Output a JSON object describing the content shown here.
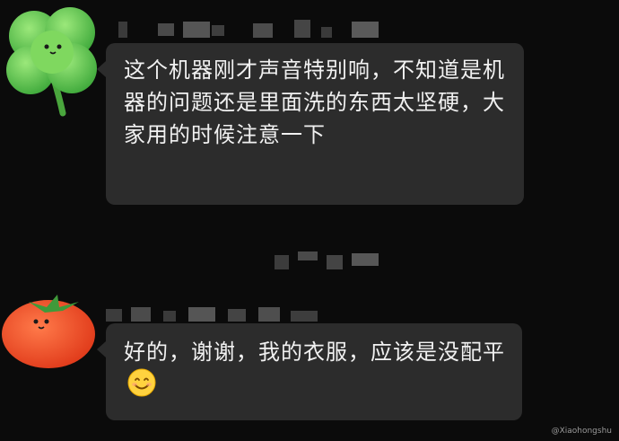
{
  "chat": {
    "messages": [
      {
        "sender_name_hidden": true,
        "avatar": "clover-avatar",
        "text": "这个机器刚才声音特别响，不知道是机器的问题还是里面洗的东西太坚硬，大家用的时候注意一下"
      },
      {
        "sender_name_hidden": true,
        "avatar": "tomato-avatar",
        "text": "好的，谢谢，我的衣服，应该是没配平",
        "emoji": "smiling-face-emoji"
      }
    ],
    "timestamp_hidden": true
  },
  "colors": {
    "background": "#0b0b0b",
    "bubble": "#2c2c2c",
    "text": "#f1f1f1"
  },
  "watermark": "@Xiaohongshu"
}
